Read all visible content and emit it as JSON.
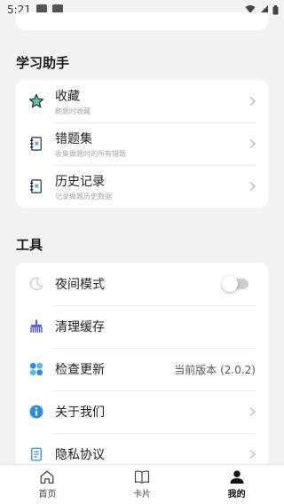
{
  "status_bar": {
    "time": "5:21"
  },
  "sections": {
    "assistant": {
      "title": "学习助手",
      "items": [
        {
          "label": "收藏",
          "sub": "刷题时收藏",
          "icon": "star-icon"
        },
        {
          "label": "错题集",
          "sub": "收集做题时的所有错题",
          "icon": "error-book-icon"
        },
        {
          "label": "历史记录",
          "sub": "记录做题历史数据",
          "icon": "history-book-icon"
        }
      ]
    },
    "tools": {
      "title": "工具",
      "items": [
        {
          "label": "夜间模式",
          "icon": "moon-icon",
          "toggle_on": false
        },
        {
          "label": "清理缓存",
          "icon": "broom-icon"
        },
        {
          "label": "检查更新",
          "icon": "update-icon",
          "value": "当前版本 (2.0.2)"
        },
        {
          "label": "关于我们",
          "icon": "info-icon"
        },
        {
          "label": "隐私协议",
          "icon": "document-icon"
        }
      ]
    }
  },
  "tabbar": {
    "items": [
      {
        "label": "首页",
        "icon": "home-icon"
      },
      {
        "label": "卡片",
        "icon": "book-icon"
      },
      {
        "label": "我的",
        "icon": "user-icon",
        "active": true
      }
    ]
  },
  "colors": {
    "accent_green": "#3bb27a",
    "accent_blue": "#2d8de0",
    "accent_indigo": "#5561d6"
  }
}
